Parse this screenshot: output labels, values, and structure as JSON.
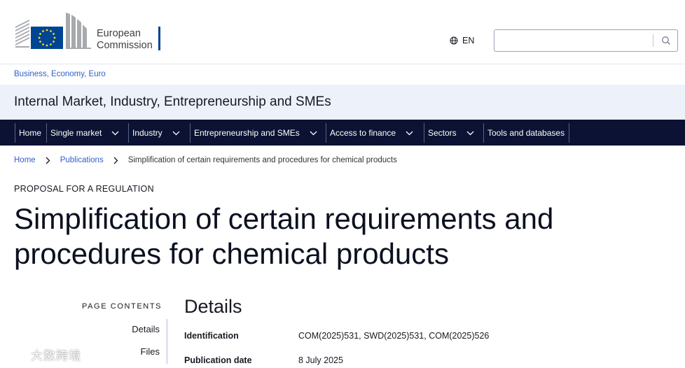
{
  "header": {
    "logo_line1": "European",
    "logo_line2": "Commission",
    "language": "EN",
    "search_placeholder": ""
  },
  "site": {
    "parent_link": "Business, Economy, Euro",
    "name": "Internal Market, Industry, Entrepreneurship and SMEs"
  },
  "nav": {
    "items": [
      {
        "label": "Home"
      },
      {
        "label": "Single market"
      },
      {
        "label": "Industry"
      },
      {
        "label": "Entrepreneurship and SMEs"
      },
      {
        "label": "Access to finance"
      },
      {
        "label": "Sectors"
      },
      {
        "label": "Tools and databases"
      }
    ]
  },
  "breadcrumb": {
    "items": [
      "Home",
      "Publications"
    ],
    "current": "Simplification of certain requirements and procedures for chemical products"
  },
  "page": {
    "eyebrow": "PROPOSAL FOR A REGULATION",
    "title": "Simplification of certain requirements and procedures for chemical products"
  },
  "page_contents": {
    "title": "PAGE CONTENTS",
    "links": [
      "Details",
      "Files"
    ]
  },
  "details": {
    "heading": "Details",
    "rows": [
      {
        "label": "Identification",
        "value": "COM(2025)531, SWD(2025)531, COM(2025)526"
      },
      {
        "label": "Publication date",
        "value": "8 July 2025"
      }
    ]
  },
  "watermark": {
    "text": "大数跨境"
  },
  "colors": {
    "nav_bg": "#0b1233",
    "link": "#2f61c8",
    "site_band": "#edf1fa",
    "eu_blue": "#004494",
    "eu_star": "#ffd617"
  }
}
